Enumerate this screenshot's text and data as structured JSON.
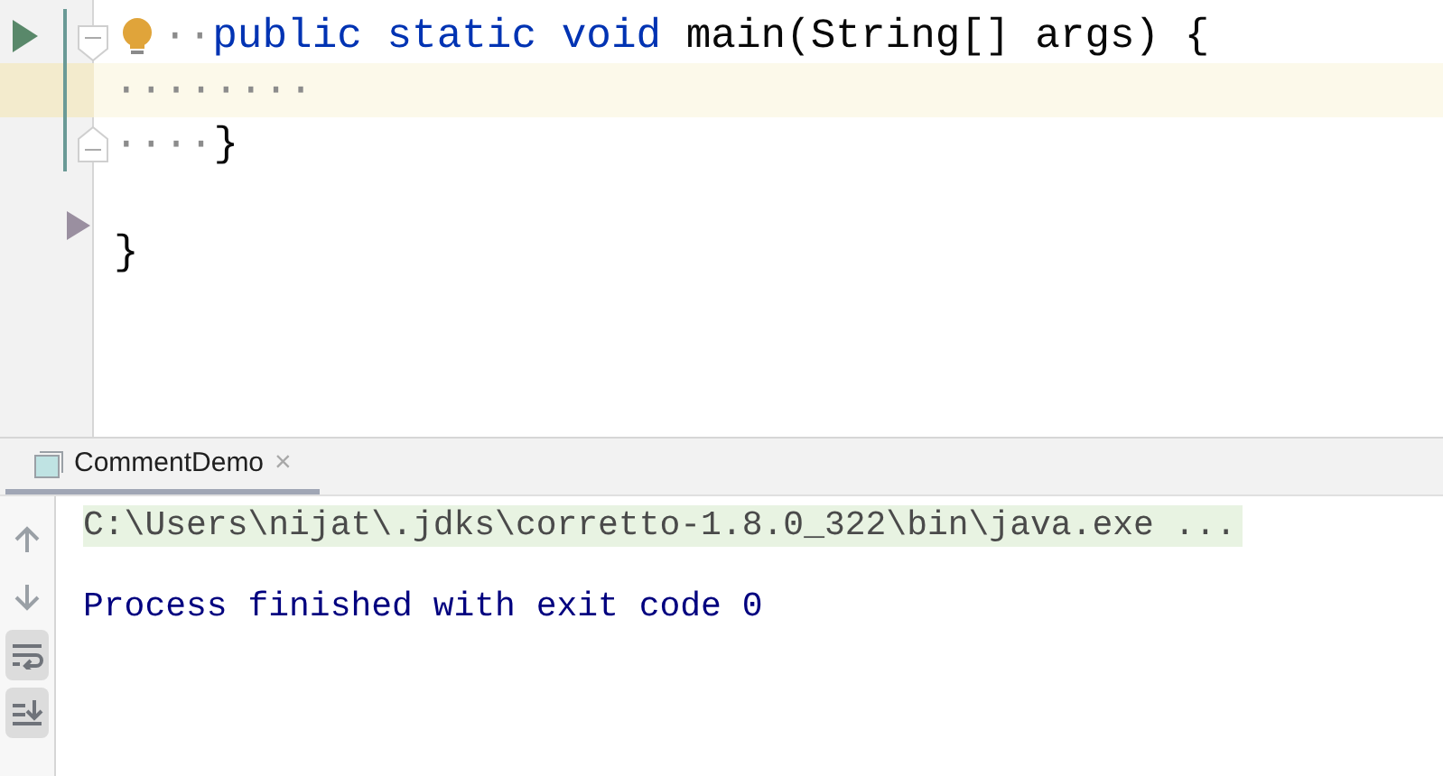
{
  "editor": {
    "lines": [
      {
        "markers": [
          {
            "kind": "run"
          },
          {
            "kind": "fold-start"
          }
        ],
        "changed": true,
        "bulb": true,
        "highlighted": false,
        "indent": "··",
        "tokens": [
          {
            "kind": "keyword",
            "text": "public static void"
          },
          {
            "kind": "plain",
            "text": " main(String[] args) {"
          }
        ]
      },
      {
        "changed": true,
        "bulb": false,
        "highlighted": true,
        "indent": "········"
      },
      {
        "markers": [
          {
            "kind": "fold-end"
          }
        ],
        "changed": true,
        "bulb": false,
        "highlighted": false,
        "indent": "····",
        "tokens": [
          {
            "kind": "plain",
            "text": "}"
          }
        ]
      },
      {
        "changed": false,
        "bulb": false,
        "highlighted": false
      },
      {
        "markers": [
          {
            "kind": "arrow"
          }
        ],
        "changed": false,
        "bulb": false,
        "highlighted": false,
        "tokens": [
          {
            "kind": "plain",
            "text": "}"
          }
        ]
      }
    ]
  },
  "console": {
    "tabs": [
      {
        "label": "CommentDemo",
        "selected": true,
        "closable": "×"
      }
    ],
    "toolbar": [
      {
        "kind": "up",
        "selected": false
      },
      {
        "kind": "down",
        "selected": false
      },
      {
        "kind": "wrap",
        "selected": true
      },
      {
        "kind": "scroll-end",
        "selected": true
      }
    ],
    "lines": [
      {
        "kind": "command",
        "text": "C:\\Users\\nijat\\.jdks\\corretto-1.8.0_322\\bin\\java.exe ..."
      },
      {
        "kind": "blank"
      },
      {
        "kind": "output",
        "text": "Process finished with exit code 0"
      }
    ]
  }
}
